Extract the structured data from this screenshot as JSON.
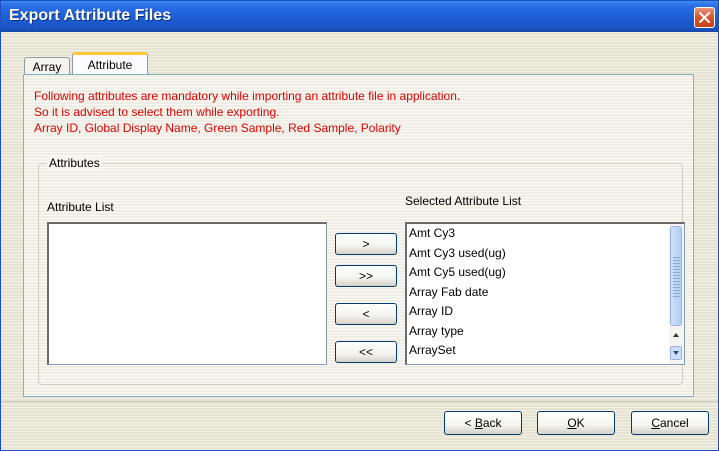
{
  "window": {
    "title": "Export Attribute Files"
  },
  "tabs": [
    {
      "label": "Array",
      "selected": false
    },
    {
      "label": "Attribute",
      "selected": true
    }
  ],
  "notice": {
    "line1": "Following attributes are mandatory while importing an attribute file in application.",
    "line2": "So it is advised to select them while exporting.",
    "line3": "Array ID, Global Display Name, Green Sample, Red Sample, Polarity",
    "color": "#e30000"
  },
  "attributes": {
    "group_label": "Attributes",
    "list_label": "Attribute List",
    "selected_label": "Selected Attribute List",
    "list_items": [],
    "selected_items": [
      "Amt Cy3",
      "Amt Cy3 used(ug)",
      "Amt Cy5 used(ug)",
      "Array Fab date",
      "Array ID",
      "Array type",
      "ArraySet"
    ]
  },
  "move_buttons": {
    "add": ">",
    "add_all": ">>",
    "remove": "<",
    "remove_all": "<<"
  },
  "footer": {
    "back_prefix": "< ",
    "back_mnemonic": "B",
    "back_rest": "ack",
    "ok_mnemonic": "O",
    "ok_rest": "K",
    "cancel_mnemonic": "C",
    "cancel_rest": "ancel"
  },
  "colors": {
    "titlebar": "#1f5fd6",
    "panel_border": "#7fb2c9",
    "active_tab_accent": "#ffc83c"
  }
}
